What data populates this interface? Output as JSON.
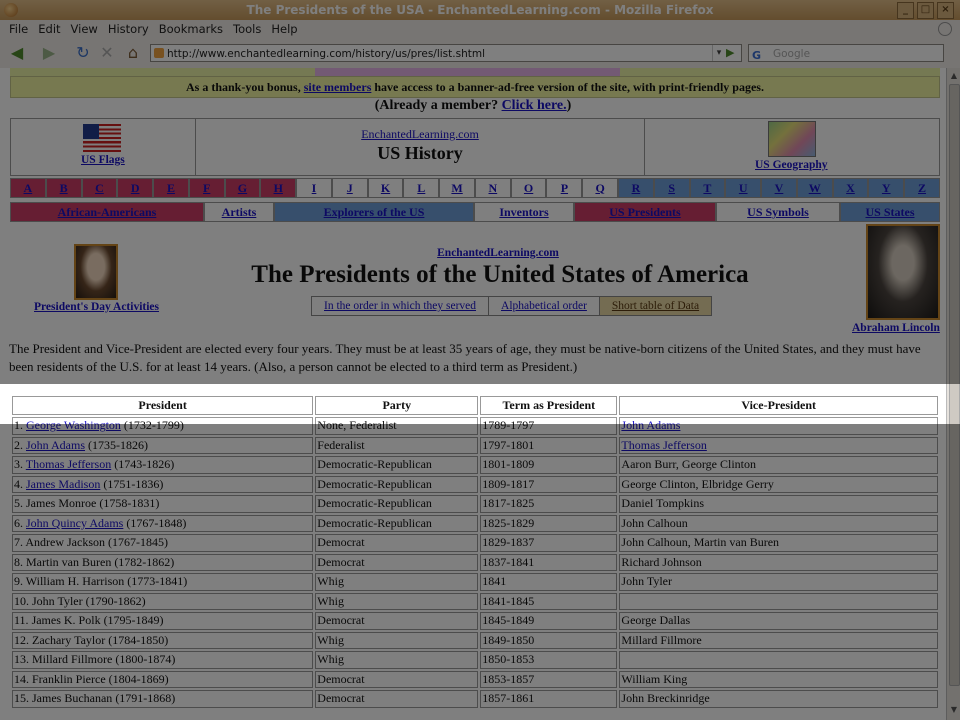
{
  "window": {
    "title": "The Presidents of the USA - EnchantedLearning.com - Mozilla Firefox",
    "btn_min": "_",
    "btn_max": "□",
    "btn_close": "×"
  },
  "menu": [
    "File",
    "Edit",
    "View",
    "History",
    "Bookmarks",
    "Tools",
    "Help"
  ],
  "nav": {
    "url": "http://www.enchantedlearning.com/history/us/pres/list.shtml",
    "search_placeholder": "Google",
    "back": "◀",
    "forward": "▶",
    "reload": "↻",
    "stop": "✕",
    "home": "⌂",
    "go": "▶",
    "dropdown": "▾",
    "search_engine": "G"
  },
  "banner": {
    "pre": "As a thank-you bonus, ",
    "link": "site members",
    "post": " have access to a banner-ad-free version of the site, with print-friendly pages.",
    "member_pre": "(Already a member? ",
    "member_link": "Click here.",
    "member_post": ")"
  },
  "header": {
    "us_flags": "US Flags",
    "enchanted": "EnchantedLearning.com",
    "us_history": "US History",
    "us_geography": "US Geography"
  },
  "alphabet": [
    {
      "l": "A",
      "c": "#cc3c67"
    },
    {
      "l": "B",
      "c": "#cc3c67"
    },
    {
      "l": "C",
      "c": "#cc3c67"
    },
    {
      "l": "D",
      "c": "#cc3c67"
    },
    {
      "l": "E",
      "c": "#cc3c67"
    },
    {
      "l": "F",
      "c": "#cc3c67"
    },
    {
      "l": "G",
      "c": "#cc3c67"
    },
    {
      "l": "H",
      "c": "#cc3c67"
    },
    {
      "l": "I",
      "c": "#ffffff"
    },
    {
      "l": "J",
      "c": "#ffffff"
    },
    {
      "l": "K",
      "c": "#ffffff"
    },
    {
      "l": "L",
      "c": "#ffffff"
    },
    {
      "l": "M",
      "c": "#ffffff"
    },
    {
      "l": "N",
      "c": "#ffffff"
    },
    {
      "l": "O",
      "c": "#ffffff"
    },
    {
      "l": "P",
      "c": "#ffffff"
    },
    {
      "l": "Q",
      "c": "#ffffff"
    },
    {
      "l": "R",
      "c": "#6f9fd8"
    },
    {
      "l": "S",
      "c": "#6f9fd8"
    },
    {
      "l": "T",
      "c": "#6f9fd8"
    },
    {
      "l": "U",
      "c": "#6f9fd8"
    },
    {
      "l": "V",
      "c": "#6f9fd8"
    },
    {
      "l": "W",
      "c": "#6f9fd8"
    },
    {
      "l": "X",
      "c": "#6f9fd8"
    },
    {
      "l": "Y",
      "c": "#6f9fd8"
    },
    {
      "l": "Z",
      "c": "#6f9fd8"
    }
  ],
  "topics": [
    {
      "t": "African-Americans",
      "c": "#cc3c67",
      "w": 194
    },
    {
      "t": "Artists",
      "c": "#ffffff",
      "w": 70
    },
    {
      "t": "Explorers of the US",
      "c": "#6f9fd8",
      "w": 200
    },
    {
      "t": "Inventors",
      "c": "#ffffff",
      "w": 100
    },
    {
      "t": "US Presidents",
      "c": "#cc3c67",
      "w": 142
    },
    {
      "t": "US Symbols",
      "c": "#ffffff",
      "w": 124
    },
    {
      "t": "US States",
      "c": "#6f9fd8",
      "w": 100
    }
  ],
  "intro": {
    "presidents_day": "President's Day Activities",
    "enchanted": "EnchantedLearning.com",
    "title": "The Presidents of the United States of America",
    "order_served": "In the order in which they served",
    "alphabetical": "Alphabetical order",
    "short_table": "Short table of Data",
    "abraham": "Abraham Lincoln",
    "paragraph": "The President and Vice-President are elected every four years. They must be at least 35 years of age, they must be native-born citizens of the United States, and they must have been residents of the U.S. for at least 14 years. (Also, a person cannot be elected to a third term as President.)"
  },
  "table": {
    "headers": [
      "President",
      "Party",
      "Term as President",
      "Vice-President"
    ],
    "rows": [
      {
        "num": "1.",
        "name": "George Washington",
        "link": true,
        "years": "(1732-1799)",
        "party": "None, Federalist",
        "term": "1789-1797",
        "vp": "John Adams",
        "vplink": true
      },
      {
        "num": "2.",
        "name": "John Adams",
        "link": true,
        "years": "(1735-1826)",
        "party": "Federalist",
        "term": "1797-1801",
        "vp": "Thomas Jefferson",
        "vplink": true
      },
      {
        "num": "3.",
        "name": "Thomas Jefferson",
        "link": true,
        "years": "(1743-1826)",
        "party": "Democratic-Republican",
        "term": "1801-1809",
        "vp": "Aaron Burr, George Clinton",
        "vplink": false
      },
      {
        "num": "4.",
        "name": "James Madison",
        "link": true,
        "years": "(1751-1836)",
        "party": "Democratic-Republican",
        "term": "1809-1817",
        "vp": "George Clinton, Elbridge Gerry",
        "vplink": false
      },
      {
        "num": "5.",
        "name": "James Monroe",
        "link": false,
        "years": "(1758-1831)",
        "party": "Democratic-Republican",
        "term": "1817-1825",
        "vp": "Daniel Tompkins",
        "vplink": false
      },
      {
        "num": "6.",
        "name": "John Quincy Adams",
        "link": true,
        "years": "(1767-1848)",
        "party": "Democratic-Republican",
        "term": "1825-1829",
        "vp": "John Calhoun",
        "vplink": false
      },
      {
        "num": "7.",
        "name": "Andrew Jackson",
        "link": false,
        "years": "(1767-1845)",
        "party": "Democrat",
        "term": "1829-1837",
        "vp": "John Calhoun, Martin van Buren",
        "vplink": false
      },
      {
        "num": "8.",
        "name": "Martin van Buren",
        "link": false,
        "years": "(1782-1862)",
        "party": "Democrat",
        "term": "1837-1841",
        "vp": "Richard Johnson",
        "vplink": false
      },
      {
        "num": "9.",
        "name": "William H. Harrison",
        "link": false,
        "years": "(1773-1841)",
        "party": "Whig",
        "term": "1841",
        "vp": "John Tyler",
        "vplink": false
      },
      {
        "num": "10.",
        "name": "John Tyler",
        "link": false,
        "years": "(1790-1862)",
        "party": "Whig",
        "term": "1841-1845",
        "vp": "",
        "vplink": false
      },
      {
        "num": "11.",
        "name": "James K. Polk",
        "link": false,
        "years": "(1795-1849)",
        "party": "Democrat",
        "term": "1845-1849",
        "vp": "George Dallas",
        "vplink": false
      },
      {
        "num": "12.",
        "name": "Zachary Taylor",
        "link": false,
        "years": "(1784-1850)",
        "party": "Whig",
        "term": "1849-1850",
        "vp": "Millard Fillmore",
        "vplink": false
      },
      {
        "num": "13.",
        "name": "Millard Fillmore",
        "link": false,
        "years": "(1800-1874)",
        "party": "Whig",
        "term": "1850-1853",
        "vp": "",
        "vplink": false
      },
      {
        "num": "14.",
        "name": "Franklin Pierce",
        "link": false,
        "years": "(1804-1869)",
        "party": "Democrat",
        "term": "1853-1857",
        "vp": "William King",
        "vplink": false
      },
      {
        "num": "15.",
        "name": "James Buchanan",
        "link": false,
        "years": "(1791-1868)",
        "party": "Democrat",
        "term": "1857-1861",
        "vp": "John Breckinridge",
        "vplink": false
      }
    ]
  }
}
